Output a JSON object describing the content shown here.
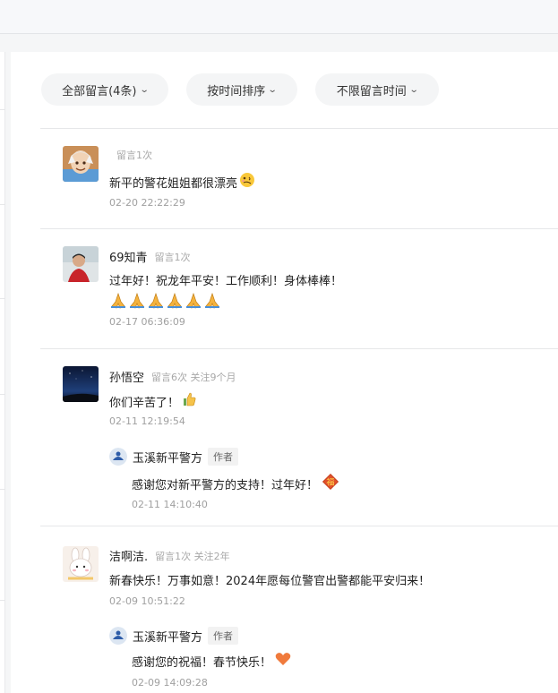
{
  "filters": {
    "all": "全部留言(4条)",
    "sort": "按时间排序",
    "time_range": "不限留言时间"
  },
  "comments": [
    {
      "name": "",
      "meta": "留言1次",
      "text": "新平的警花姐姐都很漂亮",
      "emoji": "woozy-face-icon",
      "time": "02-20 22:22:29"
    },
    {
      "name": "69知青",
      "meta": "留言1次",
      "text_line1": "过年好！祝龙年平安！工作顺利！身体棒棒！",
      "emoji_line2": "praying-hands-icon x6",
      "time": "02-17 06:36:09"
    },
    {
      "name": "孙悟空",
      "meta": "留言6次 关注9个月",
      "text": "你们辛苦了！",
      "emoji": "thumbs-up-icon",
      "time": "02-11 12:19:54",
      "reply": {
        "name": "玉溪新平警方",
        "badge": "作者",
        "text": "感谢您对新平警方的支持！过年好！",
        "emoji": "fortune-icon",
        "time": "02-11 14:10:40"
      }
    },
    {
      "name": "洁啊洁.",
      "meta": "留言1次 关注2年",
      "text": "新春快乐！万事如意！2024年愿每位警官出警都能平安归来！",
      "time": "02-09 10:51:22",
      "reply": {
        "name": "玉溪新平警方",
        "badge": "作者",
        "text": "感谢您的祝福！春节快乐！",
        "emoji": "heart-icon",
        "time": "02-09 14:09:28"
      }
    }
  ]
}
